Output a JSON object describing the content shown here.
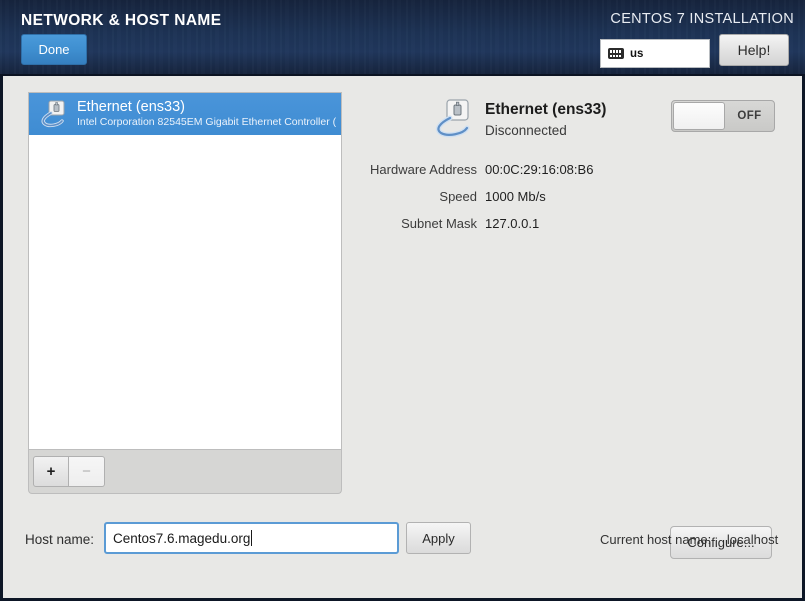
{
  "header": {
    "title": "NETWORK & HOST NAME",
    "done_label": "Done",
    "installation_label": "CENTOS 7 INSTALLATION",
    "keyboard_layout": "us",
    "keyboard_icon": "keyboard-icon",
    "help_label": "Help!"
  },
  "device_list": {
    "items": [
      {
        "name": "Ethernet (ens33)",
        "description": "Intel Corporation 82545EM Gigabit Ethernet Controller (",
        "icon": "wired-network-icon",
        "selected": true
      }
    ],
    "toolbar": {
      "add_label": "+",
      "remove_label": "−"
    }
  },
  "detail": {
    "icon": "wired-network-unplugged-icon",
    "name": "Ethernet (ens33)",
    "state": "Disconnected",
    "toggle": {
      "label": "OFF",
      "state": "off"
    },
    "rows": [
      {
        "label": "Hardware Address",
        "value": "00:0C:29:16:08:B6"
      },
      {
        "label": "Speed",
        "value": "1000 Mb/s"
      },
      {
        "label": "Subnet Mask",
        "value": "127.0.0.1"
      }
    ],
    "configure_label": "Configure..."
  },
  "hostname_bar": {
    "label": "Host name:",
    "value": "Centos7.6.magedu.org",
    "apply_label": "Apply",
    "current_label": "Current host name:",
    "current_value": "localhost"
  },
  "colors": {
    "header_bg": "#1d3355",
    "accent_blue": "#3f8fd0",
    "selection_blue": "#4a95da",
    "body_bg": "#e8e8e6",
    "focus_border": "#5b9bd5"
  }
}
